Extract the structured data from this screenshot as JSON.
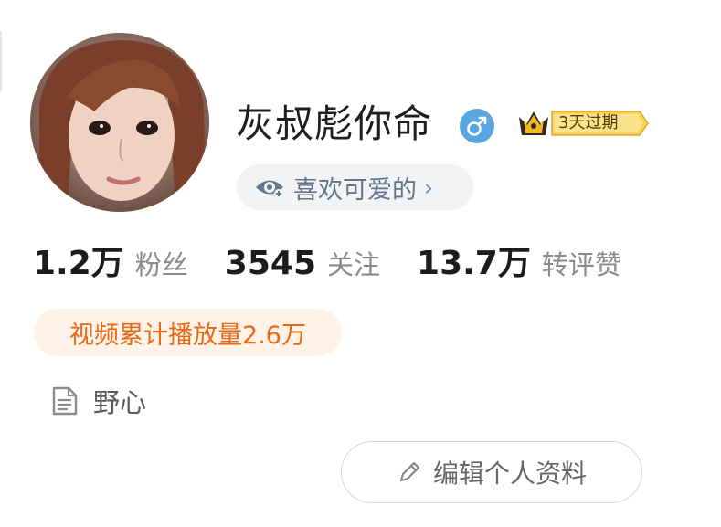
{
  "profile": {
    "name": "灰叔彪你命",
    "gender_icon": "male-icon",
    "vip_badge": "3天过期",
    "interest_tag": "喜欢可爱的",
    "interest_icon": "eye-icon",
    "stats": [
      {
        "value": "1.2万",
        "label": "粉丝"
      },
      {
        "value": "3545",
        "label": "关注"
      },
      {
        "value": "13.7万",
        "label": "转评赞"
      }
    ],
    "video_plays": "视频累计播放量2.6万",
    "bio": "野心",
    "bio_icon": "document-icon",
    "edit_button": "编辑个人资料",
    "edit_icon": "pencil-icon"
  },
  "colors": {
    "gender": "#5aa6e0",
    "play_text": "#ea6a14",
    "play_bg": "#fff3e9",
    "vip_gold": "#f4c24a",
    "tag_bg": "#f2f3f5",
    "tag_text": "#66758a"
  }
}
